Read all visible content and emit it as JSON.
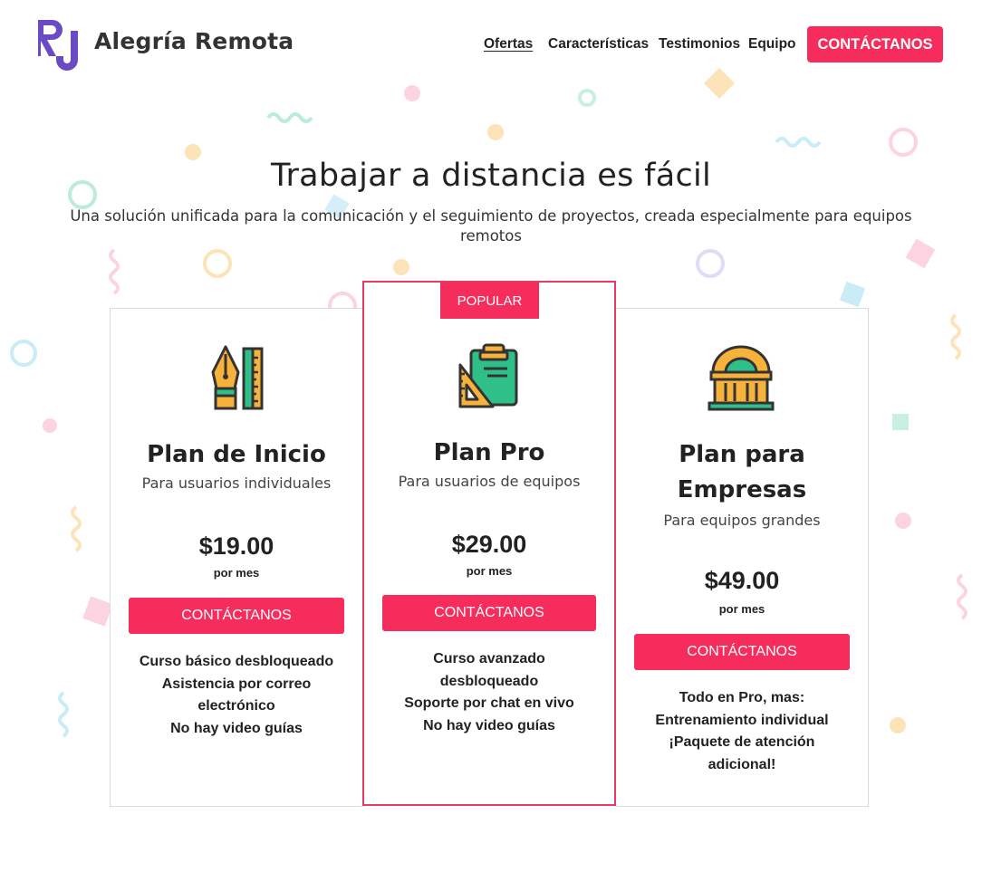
{
  "header": {
    "logo_text": "RJ",
    "brand": "Alegría Remota",
    "nav": [
      "Ofertas",
      "Características",
      "Testimonios",
      "Equipo"
    ],
    "cta": "CONTÁCTANOS"
  },
  "hero": {
    "title": "Trabajar a distancia es fácil",
    "subtitle": "Una solución unificada para la comunicación y el seguimiento de proyectos, creada especialmente para equipos remotos"
  },
  "plans": [
    {
      "icon": "pen-ruler-icon",
      "name": "Plan de Inicio",
      "audience": "Para usuarios individuales",
      "price": "$19.00",
      "period": "por mes",
      "cta": "CONTÁCTANOS",
      "features": [
        "Curso básico desbloqueado",
        "Asistencia por correo electrónico",
        "No hay video guías"
      ]
    },
    {
      "badge": "POPULAR",
      "icon": "clipboard-triangle-icon",
      "name": "Plan Pro",
      "audience": "Para usuarios de equipos",
      "price": "$29.00",
      "period": "por mes",
      "cta": "CONTÁCTANOS",
      "features": [
        "Curso avanzado desbloqueado",
        "Soporte por chat en vivo",
        "No hay video guías"
      ]
    },
    {
      "icon": "building-icon",
      "name": "Plan para Empresas",
      "audience": "Para equipos grandes",
      "price": "$49.00",
      "period": "por mes",
      "cta": "CONTÁCTANOS",
      "features": [
        "Todo en Pro, mas:",
        "Entrenamiento individual",
        "¡Paquete de atención adicional!"
      ]
    }
  ],
  "colors": {
    "accent": "#f52c5c",
    "popular_border": "#e83a62",
    "logo": "#6a4bc4",
    "icon_yellow": "#f7b23b",
    "icon_green": "#2fc08a",
    "icon_dark": "#333333"
  }
}
